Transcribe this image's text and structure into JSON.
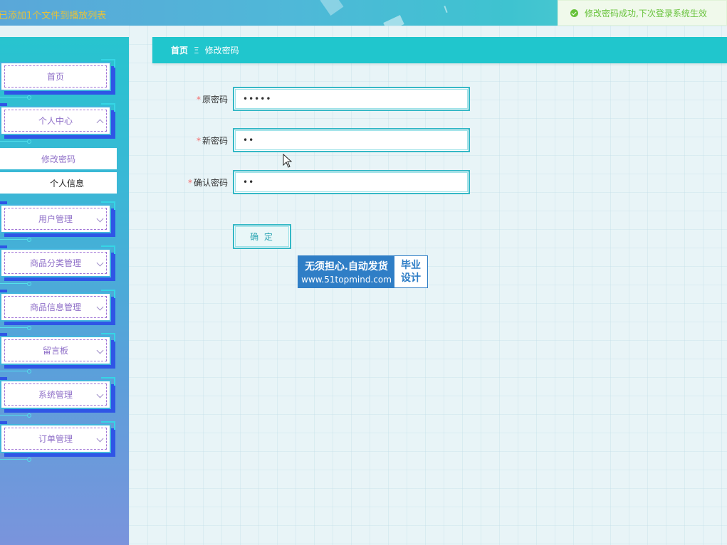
{
  "topbar": {
    "marquee": "已添加1个文件到播放列表",
    "toast": "修改密码成功,下次登录系统生效"
  },
  "sidebar": {
    "items": [
      {
        "label": "首页"
      },
      {
        "label": "个人中心"
      },
      {
        "label": "用户管理"
      },
      {
        "label": "商品分类管理"
      },
      {
        "label": "商品信息管理"
      },
      {
        "label": "留言板"
      },
      {
        "label": "系统管理"
      },
      {
        "label": "订单管理"
      }
    ],
    "submenu": [
      {
        "label": "修改密码"
      },
      {
        "label": "个人信息"
      }
    ]
  },
  "breadcrumb": {
    "home": "首页",
    "separator": "Ξ",
    "current": "修改密码"
  },
  "form": {
    "old_password": {
      "label": "原密码",
      "value": "•••••"
    },
    "new_password": {
      "label": "新密码",
      "value": "••"
    },
    "confirm_password": {
      "label": "确认密码",
      "value": "••"
    },
    "submit_label": "确 定",
    "required_mark": "*"
  },
  "watermark": {
    "line1": "无须担心.自动发货",
    "line2": "www.51topmind.com",
    "right1": "毕业",
    "right2": "设计"
  },
  "colors": {
    "accent": "#20c6cd",
    "toast_text": "#67c23a",
    "menu_text": "#8f6fc8"
  }
}
